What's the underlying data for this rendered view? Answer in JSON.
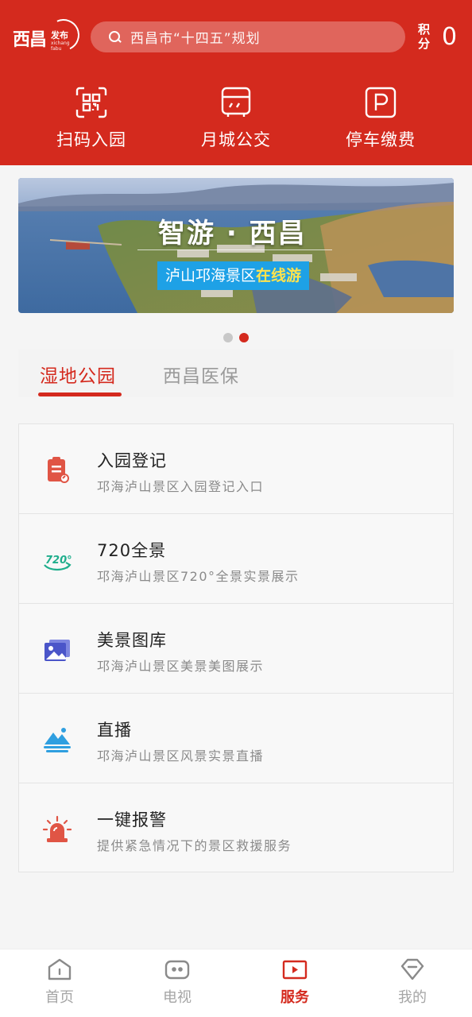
{
  "header": {
    "logo": {
      "text": "西昌",
      "badge": "发布",
      "sub": "xichang fabu"
    },
    "search": {
      "placeholder": "西昌市“十四五”规划",
      "icon": "search-icon"
    },
    "points": {
      "label": "积分",
      "value": "0"
    },
    "quick_actions": [
      {
        "label": "扫码入园",
        "icon": "qr-scan-icon"
      },
      {
        "label": "月城公交",
        "icon": "bus-icon"
      },
      {
        "label": "停车缴费",
        "icon": "parking-icon"
      }
    ],
    "color": "#d42a1e"
  },
  "banner": {
    "title": "智游 · 西昌",
    "subtitle_prefix": "泸山邛海景区",
    "subtitle_highlight": "在线游",
    "page_count": 2,
    "active_page": 2
  },
  "tabs": [
    {
      "label": "湿地公园",
      "active": true
    },
    {
      "label": "西昌医保",
      "active": false
    }
  ],
  "services": [
    {
      "title": "入园登记",
      "desc": "邛海泸山景区入园登记入口",
      "icon": "clipboard-icon"
    },
    {
      "title": "720全景",
      "desc": "邛海泸山景区720°全景实景展示",
      "icon": "panorama-720-icon"
    },
    {
      "title": "美景图库",
      "desc": "邛海泸山景区美景美图展示",
      "icon": "gallery-icon"
    },
    {
      "title": "直播",
      "desc": "邛海泸山景区风景实景直播",
      "icon": "mountain-live-icon"
    },
    {
      "title": "一键报警",
      "desc": "提供紧急情况下的景区救援服务",
      "icon": "alarm-siren-icon"
    }
  ],
  "bottom_nav": [
    {
      "label": "首页",
      "icon": "home-icon",
      "active": false
    },
    {
      "label": "电视",
      "icon": "tv-icon",
      "active": false
    },
    {
      "label": "服务",
      "icon": "play-service-icon",
      "active": true
    },
    {
      "label": "我的",
      "icon": "profile-icon",
      "active": false
    }
  ],
  "colors": {
    "accent": "#d42a1e",
    "inactive": "#a5a5a5",
    "banner_tag": "#1ea1e6"
  }
}
